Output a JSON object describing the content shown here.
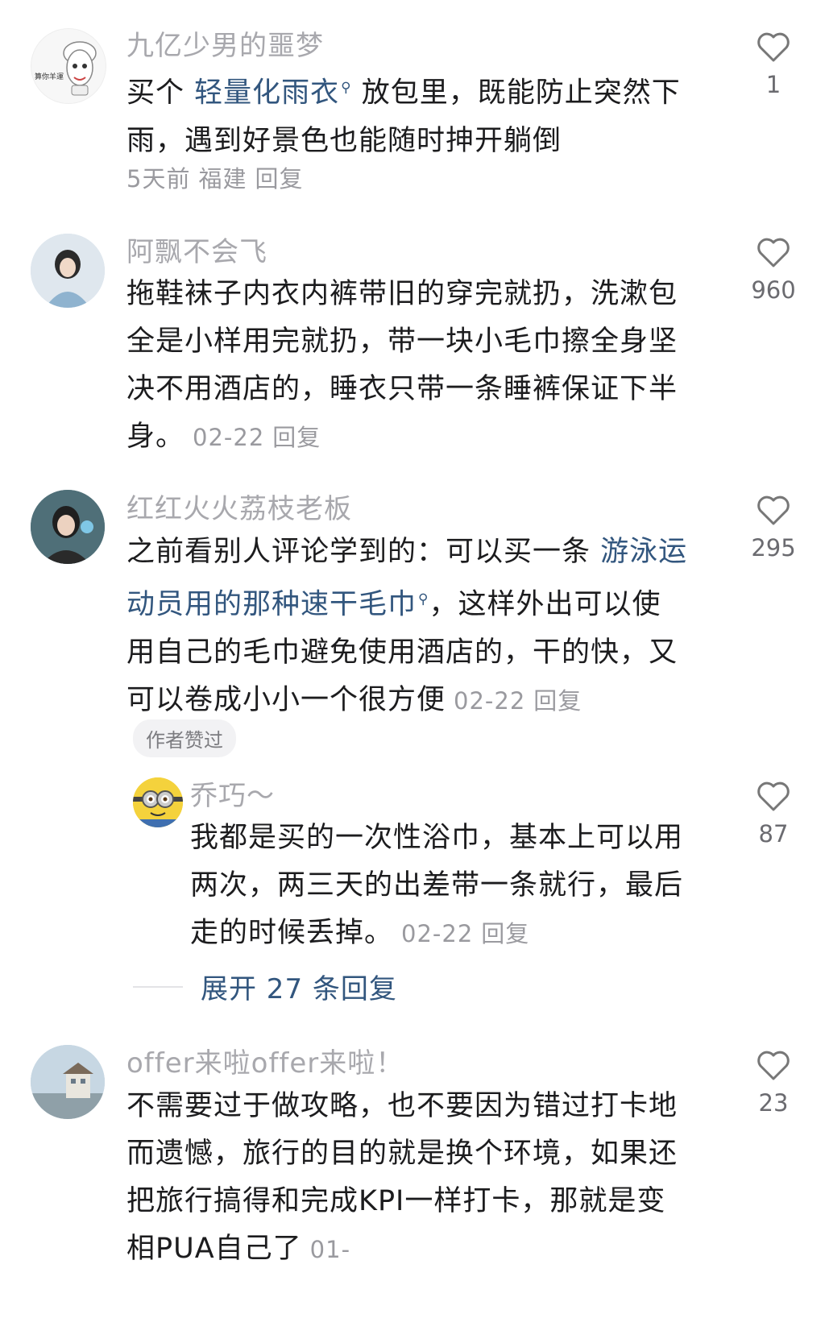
{
  "comments": [
    {
      "username": "九亿少男的噩梦",
      "avatar_text": "算你羊運",
      "lines": [
        {
          "pre": "买个 ",
          "link": "轻量化雨衣",
          "post": " 放包里，既能防止突然下"
        },
        {
          "text": "雨，遇到好景色也能随时抻开躺倒"
        }
      ],
      "meta": {
        "time": "5天前",
        "location": "福建",
        "reply": "回复"
      },
      "likes": "1"
    },
    {
      "username": "阿飘不会飞",
      "lines": [
        {
          "text": "拖鞋袜子内衣内裤带旧的穿完就扔，洗漱包"
        },
        {
          "text": "全是小样用完就扔，带一块小毛巾擦全身坚"
        },
        {
          "text": "决不用酒店的，睡衣只带一条睡裤保证下半"
        },
        {
          "text": "身。"
        }
      ],
      "meta": {
        "time": "02-22",
        "reply": "回复"
      },
      "likes": "960"
    },
    {
      "username": "红红火火荔枝老板",
      "lines": [
        {
          "pre": "之前看别人评论学到的：可以买一条 ",
          "link": "游泳运"
        },
        {
          "link": "动员用的那种速干毛巾",
          "post": "，这样外出可以使"
        },
        {
          "text": "用自己的毛巾避免使用酒店的，干的快，又"
        },
        {
          "text": "可以卷成小小一个很方便"
        }
      ],
      "meta": {
        "time": "02-22",
        "reply": "回复"
      },
      "likes": "295",
      "author_badge": "作者赞过"
    },
    {
      "username": "乔巧～",
      "lines": [
        {
          "text": "我都是买的一次性浴巾，基本上可以用"
        },
        {
          "text": "两次，两三天的出差带一条就行，最后"
        },
        {
          "text": "走的时候丢掉。"
        }
      ],
      "meta": {
        "time": "02-22",
        "reply": "回复"
      },
      "likes": "87",
      "expand_label": "展开 27 条回复"
    },
    {
      "username": "offer来啦offer来啦！",
      "lines": [
        {
          "text": "不需要过于做攻略，也不要因为错过打卡地"
        },
        {
          "text": "而遗憾，旅行的目的就是换个环境，如果还"
        },
        {
          "text": "把旅行搞得和完成KPI一样打卡，那就是变"
        },
        {
          "text": "相PUA自己了"
        }
      ],
      "meta": {
        "time": "01-"
      },
      "likes": "23"
    }
  ],
  "colors": {
    "link": "#32567e",
    "username": "#a8a8ad",
    "meta": "#9a9a9f",
    "text": "#1c1c1e"
  },
  "icons": {
    "like": "heart-outline-icon",
    "search_link": "search-mark-icon"
  }
}
